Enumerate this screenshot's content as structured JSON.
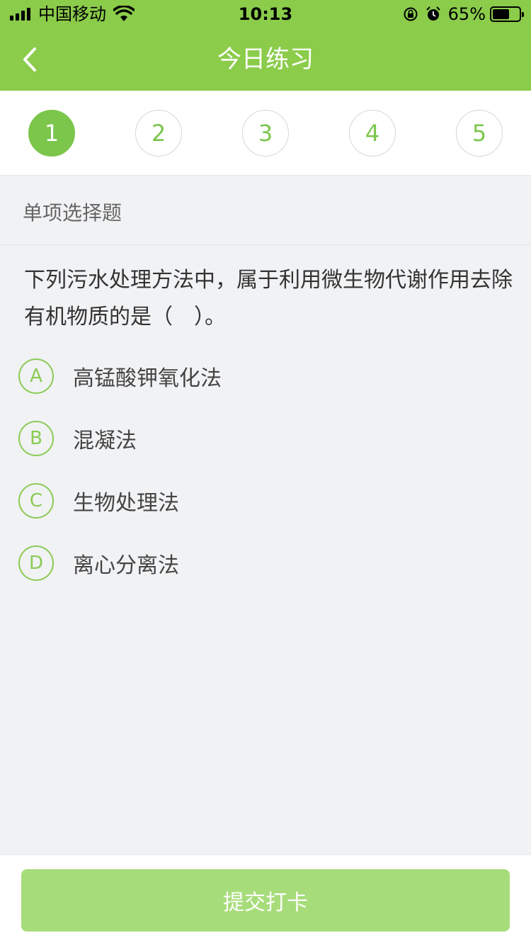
{
  "status_bar": {
    "carrier": "中国移动",
    "time": "10:13",
    "battery_percent": "65%",
    "battery_level": 0.65
  },
  "nav": {
    "title": "今日练习"
  },
  "steps": [
    "1",
    "2",
    "3",
    "4",
    "5"
  ],
  "active_step": 1,
  "question_type": "单项选择题",
  "question": {
    "text": "下列污水处理方法中，属于利用微生物代谢作用去除有机物质的是（　）。",
    "options": [
      {
        "letter": "A",
        "text": "高锰酸钾氧化法"
      },
      {
        "letter": "B",
        "text": "混凝法"
      },
      {
        "letter": "C",
        "text": "生物处理法"
      },
      {
        "letter": "D",
        "text": "离心分离法"
      }
    ]
  },
  "submit_label": "提交打卡",
  "colors": {
    "accent": "#8bcc4b",
    "option_border": "#8acb55",
    "submit_bg": "#a7dc7a",
    "page_bg": "#f1f2f4"
  }
}
